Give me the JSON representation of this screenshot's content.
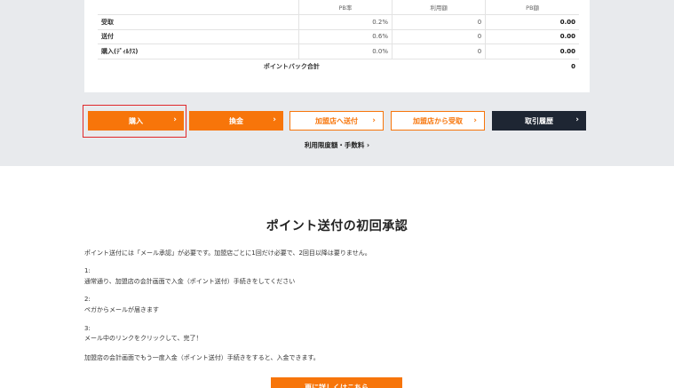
{
  "table": {
    "headers": [
      "",
      "PB率",
      "利用額",
      "PB額"
    ],
    "rows": [
      {
        "label": "受取",
        "rate": "0.2%",
        "amount": "0",
        "pb": "0.00"
      },
      {
        "label": "送付",
        "rate": "0.6%",
        "amount": "0",
        "pb": "0.00"
      },
      {
        "label": "購入(ﾃﾞｨﾙｸｽ)",
        "rate": "0.0%",
        "amount": "0",
        "pb": "0.00"
      }
    ],
    "total_label": "ポイントバック合計",
    "total_value": "0"
  },
  "actions": {
    "purchase": "購入",
    "exchange": "換金",
    "send_to_store": "加盟店へ送付",
    "receive_from_store": "加盟店から受取",
    "history": "取引履歴",
    "chevron": "›"
  },
  "limits_link": "利用限度額・手数料 ›",
  "approval": {
    "title": "ポイント送付の初回承認",
    "intro": "ポイント送付には「メール承認」が必要です。加盟店ごとに1回だけ必要で、2回目以降は要りません。",
    "step1_num": "1:",
    "step1_text": "通常通り、加盟店の会計画面で入金（ポイント送付）手続きをしてください",
    "step2_num": "2:",
    "step2_text": "ペガからメールが届きます",
    "step3_num": "3:",
    "step3_text": "メール中のリンクをクリックして、完了！",
    "note": "加盟店の会計画面でもう一度入金（ポイント送付）手続きをすると、入金できます。",
    "bottom_button": "更に詳しくはこちら"
  },
  "colors": {
    "accent": "#f7750a",
    "dark": "#1e2633",
    "highlight": "#e0282a",
    "band": "#e8eaed"
  }
}
